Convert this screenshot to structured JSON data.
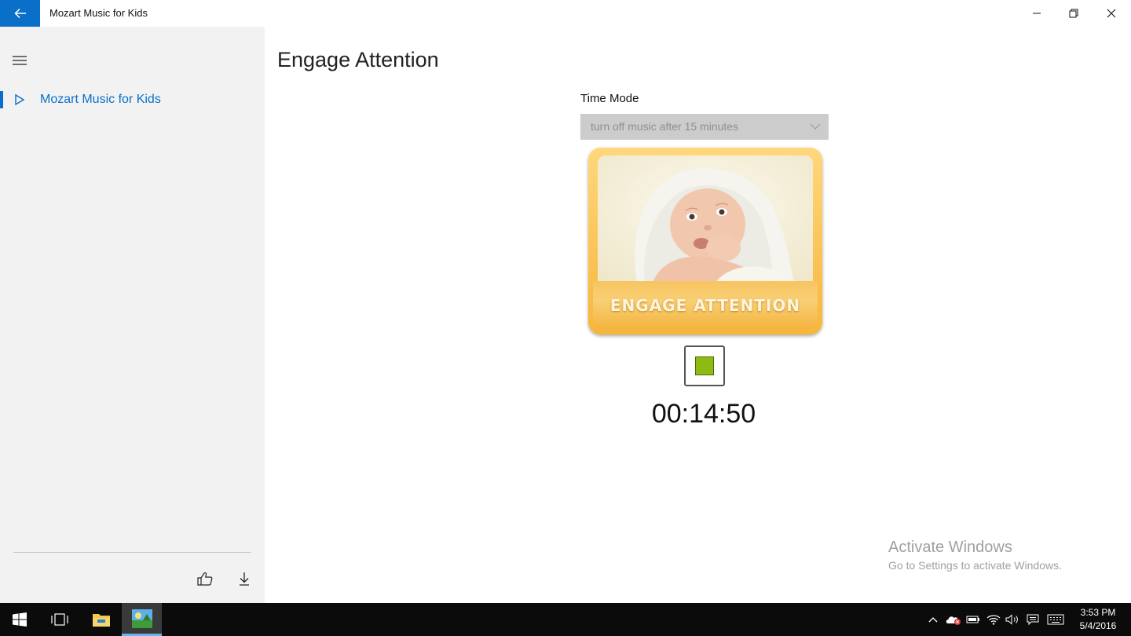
{
  "window": {
    "title": "Mozart Music for Kids"
  },
  "sidebar": {
    "items": [
      {
        "label": "Mozart Music for Kids",
        "selected": true,
        "icon": "play-outline-icon"
      }
    ]
  },
  "main": {
    "page_title": "Engage Attention",
    "time_mode": {
      "label": "Time Mode",
      "selected_value": "turn off music after 15 minutes"
    },
    "card": {
      "banner_text": "ENGAGE ATTENTION",
      "image": "baby-photo"
    },
    "timer": "00:14:50"
  },
  "watermark": {
    "title": "Activate Windows",
    "subtitle": "Go to Settings to activate Windows."
  },
  "taskbar": {
    "time": "3:53 PM",
    "date": "5/4/2016"
  },
  "colors": {
    "accent": "#0a6fc9",
    "stop_square": "#8dbb12",
    "card_orange": "#f7b63a"
  }
}
